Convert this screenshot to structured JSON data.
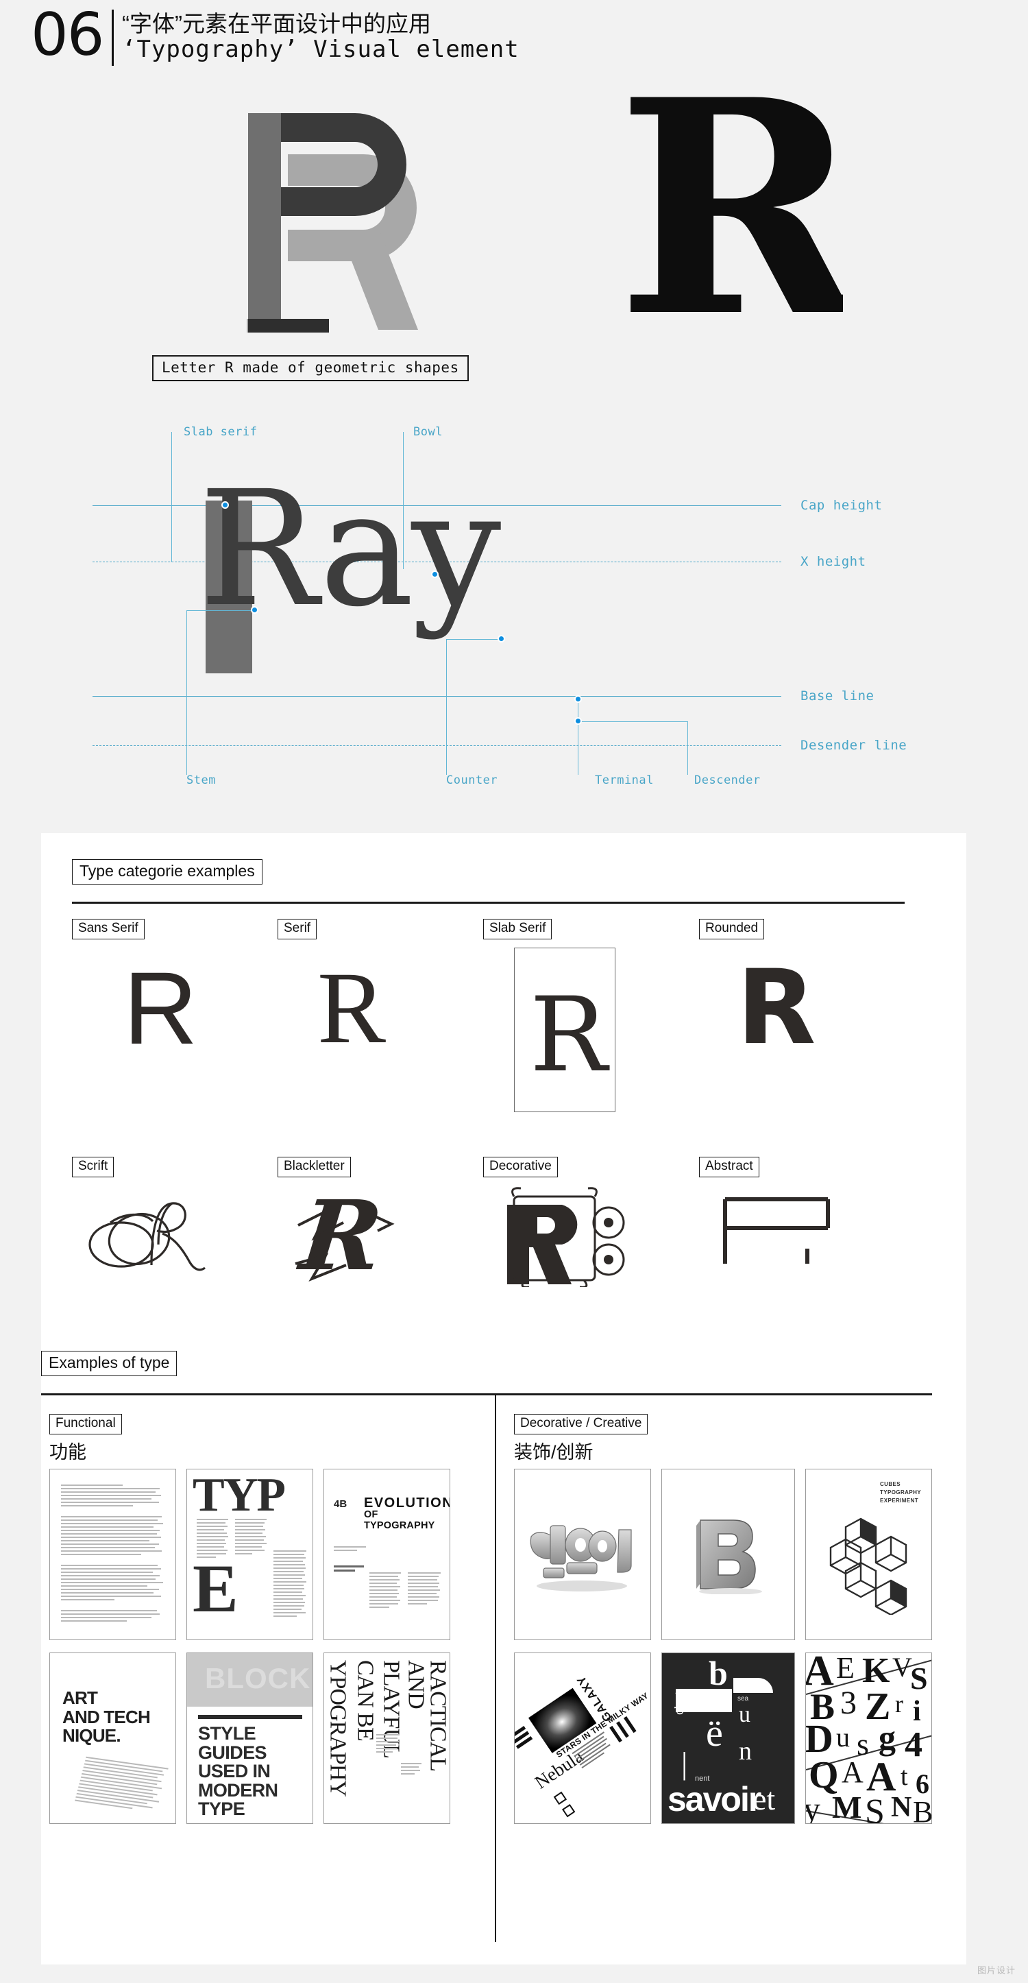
{
  "header": {
    "number": "06",
    "title_cn": "“字体”元素在平面设计中的应用",
    "title_en": "‘Typography’  Visual element"
  },
  "geometric": {
    "caption": "Letter R made of geometric shapes",
    "colors": {
      "dark": "#3a3a3a",
      "mid": "#6f6f6f",
      "light": "#a8a8a8",
      "solid": "#0d0d0d"
    }
  },
  "anatomy": {
    "word": "Ray",
    "labels_top": [
      {
        "text": "Slab serif"
      },
      {
        "text": "Bowl"
      }
    ],
    "labels_bottom": [
      {
        "text": "Stem"
      },
      {
        "text": "Counter"
      },
      {
        "text": "Terminal"
      },
      {
        "text": "Descender"
      }
    ],
    "guides": [
      {
        "text": "Cap height",
        "style": "solid"
      },
      {
        "text": "X height",
        "style": "dashed"
      },
      {
        "text": "Base line",
        "style": "solid"
      },
      {
        "text": "Desender line",
        "style": "dashed"
      }
    ],
    "accent_color": "#4aa6c8",
    "dot_color": "#0d8ee0"
  },
  "categories": {
    "section_label": "Type categorie examples",
    "items": [
      {
        "label": "Sans Serif",
        "glyph": "R",
        "framed": false
      },
      {
        "label": "Serif",
        "glyph": "R",
        "framed": false
      },
      {
        "label": "Slab Serif",
        "glyph": "R",
        "framed": true
      },
      {
        "label": "Rounded",
        "glyph": "R",
        "framed": false
      },
      {
        "label": "Scrift",
        "glyph": "R",
        "framed": false
      },
      {
        "label": "Blackletter",
        "glyph": "R",
        "framed": false
      },
      {
        "label": "Decorative",
        "glyph": "R",
        "framed": false
      },
      {
        "label": "Abstract",
        "glyph": "R",
        "framed": false
      }
    ]
  },
  "examples": {
    "section_label": "Examples of type",
    "left": {
      "tag": "Functional",
      "cn": "功能",
      "posters": [
        {
          "name": "text-document-poster",
          "headline": "",
          "kind": "text-page"
        },
        {
          "name": "type-poster",
          "headline": "TYPE",
          "kind": "type-big"
        },
        {
          "name": "evolution-poster",
          "headline": "EVOLUTION",
          "sub": "OF TYPOGRAPHY",
          "corner": "4B",
          "kind": "evolution"
        },
        {
          "name": "art-and-technique-poster",
          "headline": "ART AND TECH NIQUE.",
          "kind": "art-tech"
        },
        {
          "name": "style-guides-poster",
          "banner": "BLOCK",
          "headline": "STYLE GUIDES USED IN MODERN TYPE",
          "kind": "style-guides"
        },
        {
          "name": "playful-practical-poster",
          "headline": "TYPOGRAPHY CAN BE PLAYFUL AND PRACTICAL",
          "kind": "vertical-serif"
        }
      ]
    },
    "right": {
      "tag": "Decorative / Creative",
      "cn": "装饰/创新",
      "posters": [
        {
          "name": "color-3d-poster",
          "headline": "COLOR",
          "kind": "color3d"
        },
        {
          "name": "letter-b-3d-poster",
          "headline": "B",
          "kind": "b3d"
        },
        {
          "name": "cubes-poster",
          "headline": "CUBES",
          "kind": "cubes"
        },
        {
          "name": "nebula-galaxy-poster",
          "headline": "Nebula",
          "sub": "STARS IN THE MILKY WAY",
          "sub2": "GALAXY",
          "kind": "nebula"
        },
        {
          "name": "savoir-et-poster",
          "headline": "savoir",
          "sub": "c'est",
          "kind": "savoir"
        },
        {
          "name": "letter-collage-poster",
          "headline": "",
          "kind": "collage"
        }
      ]
    }
  },
  "watermark": "图片设计"
}
